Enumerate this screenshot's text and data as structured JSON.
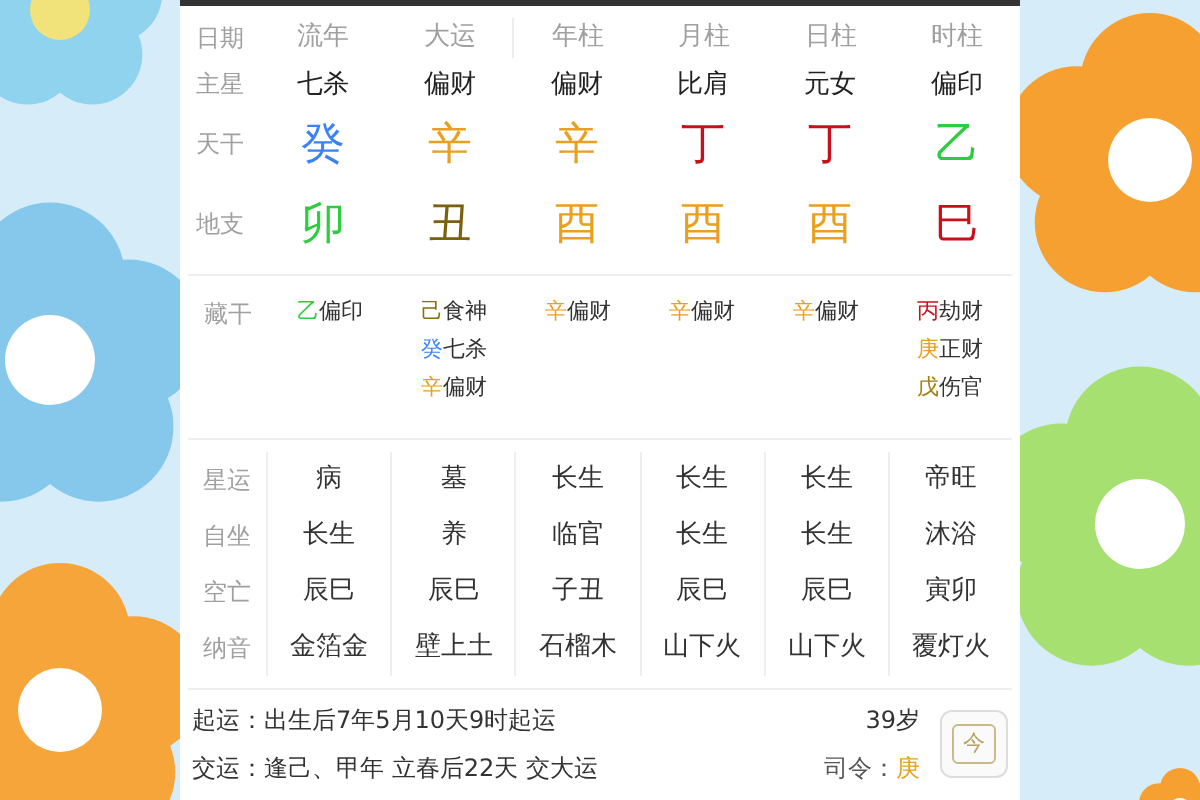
{
  "header": {
    "label": "日期",
    "columns": [
      "流年",
      "大运",
      "年柱",
      "月柱",
      "日柱",
      "时柱"
    ]
  },
  "main_star": {
    "label": "主星",
    "cells": [
      "七杀",
      "偏财",
      "偏财",
      "比肩",
      "元女",
      "偏印"
    ]
  },
  "heavenly_stems": {
    "label": "天干",
    "cells": [
      {
        "text": "癸",
        "color": "#3b82f6"
      },
      {
        "text": "辛",
        "color": "#e8a020"
      },
      {
        "text": "辛",
        "color": "#e8a020"
      },
      {
        "text": "丁",
        "color": "#c8101a"
      },
      {
        "text": "丁",
        "color": "#c8101a"
      },
      {
        "text": "乙",
        "color": "#2ecc40"
      }
    ]
  },
  "earthly_branches": {
    "label": "地支",
    "cells": [
      {
        "text": "卯",
        "color": "#2ecc40"
      },
      {
        "text": "丑",
        "color": "#7a6010"
      },
      {
        "text": "酉",
        "color": "#e8a020"
      },
      {
        "text": "酉",
        "color": "#e8a020"
      },
      {
        "text": "酉",
        "color": "#e8a020"
      },
      {
        "text": "巳",
        "color": "#c8101a"
      }
    ]
  },
  "hidden_stems": {
    "label": "藏干",
    "cells": [
      [
        {
          "stem": "乙",
          "color": "#2ecc40",
          "god": "偏印"
        }
      ],
      [
        {
          "stem": "己",
          "color": "#8a6d10",
          "god": "食神"
        },
        {
          "stem": "癸",
          "color": "#3b82f6",
          "god": "七杀"
        },
        {
          "stem": "辛",
          "color": "#e8a020",
          "god": "偏财"
        }
      ],
      [
        {
          "stem": "辛",
          "color": "#e8a020",
          "god": "偏财"
        }
      ],
      [
        {
          "stem": "辛",
          "color": "#e8a020",
          "god": "偏财"
        }
      ],
      [
        {
          "stem": "辛",
          "color": "#e8a020",
          "god": "偏财"
        }
      ],
      [
        {
          "stem": "丙",
          "color": "#c8101a",
          "god": "劫财"
        },
        {
          "stem": "庚",
          "color": "#e8a020",
          "god": "正财"
        },
        {
          "stem": "戊",
          "color": "#a08010",
          "god": "伤官"
        }
      ]
    ]
  },
  "detail_rows": [
    {
      "label": "星运",
      "cells": [
        "病",
        "墓",
        "长生",
        "长生",
        "长生",
        "帝旺"
      ]
    },
    {
      "label": "自坐",
      "cells": [
        "长生",
        "养",
        "临官",
        "长生",
        "长生",
        "沐浴"
      ]
    },
    {
      "label": "空亡",
      "cells": [
        "辰巳",
        "辰巳",
        "子丑",
        "辰巳",
        "辰巳",
        "寅卯"
      ]
    },
    {
      "label": "纳音",
      "cells": [
        "金箔金",
        "壁上土",
        "石榴木",
        "山下火",
        "山下火",
        "覆灯火"
      ]
    }
  ],
  "footer": {
    "start_luck": "起运：出生后7年5月10天9时起运",
    "luck_change": "交运：逢己、甲年 立春后22天 交大运",
    "age": "39岁",
    "commander_label": "司令：",
    "commander_stem": {
      "text": "庚",
      "color": "#e8a020"
    },
    "today_button": "今"
  }
}
